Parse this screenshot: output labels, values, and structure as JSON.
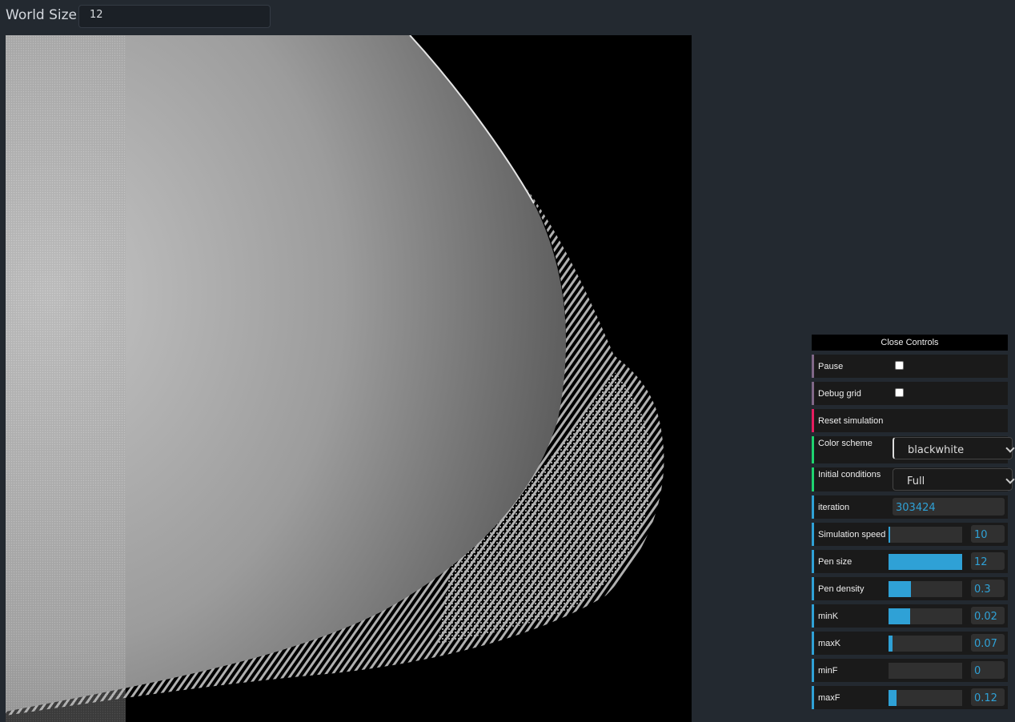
{
  "world_size": {
    "label": "World Size:",
    "value": "12"
  },
  "canvas": {
    "description_icon": "reaction-diffusion-canvas"
  },
  "controls": {
    "close_label": "Close Controls",
    "pause": {
      "label": "Pause",
      "checked": false
    },
    "debug_grid": {
      "label": "Debug grid",
      "checked": false
    },
    "reset": {
      "label": "Reset simulation"
    },
    "color_scheme": {
      "label": "Color scheme",
      "value": "blackwhite"
    },
    "initial_conditions": {
      "label": "Initial conditions",
      "value": "Full"
    },
    "iteration": {
      "label": "iteration",
      "value": "303424"
    },
    "sliders": [
      {
        "label": "Simulation speed",
        "value": "10",
        "fill": 0.02
      },
      {
        "label": "Pen size",
        "value": "12",
        "fill": 1.0
      },
      {
        "label": "Pen density",
        "value": "0.3",
        "fill": 0.3
      },
      {
        "label": "minK",
        "value": "0.02",
        "fill": 0.29
      },
      {
        "label": "maxK",
        "value": "0.07",
        "fill": 0.05
      },
      {
        "label": "minF",
        "value": "0",
        "fill": 0.0
      },
      {
        "label": "maxF",
        "value": "0.12",
        "fill": 0.11
      }
    ]
  },
  "colors": {
    "accent": "#2fa1d6",
    "background": "#232930",
    "panel": "#1a1a1a"
  }
}
